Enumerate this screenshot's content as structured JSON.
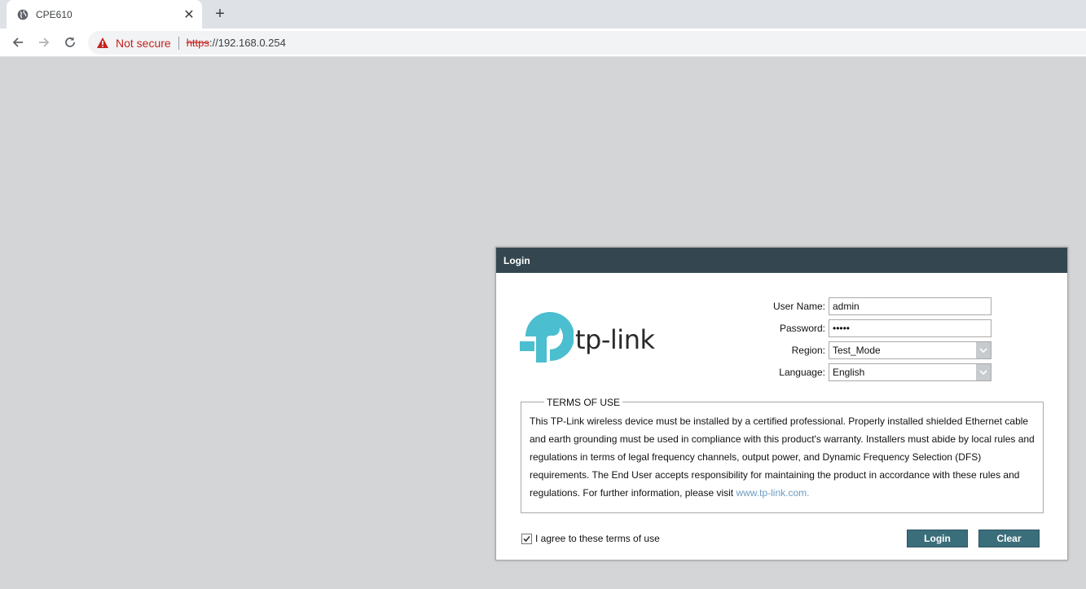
{
  "browser": {
    "tab_title": "CPE610",
    "security_label": "Not secure",
    "url_scheme": "https",
    "url_rest": "://192.168.0.254"
  },
  "dialog": {
    "title": "Login",
    "logo_text": "tp-link",
    "fields": {
      "username_label": "User Name:",
      "username_value": "admin",
      "password_label": "Password:",
      "password_value": "•••••",
      "region_label": "Region:",
      "region_value": "Test_Mode",
      "language_label": "Language:",
      "language_value": "English"
    },
    "terms": {
      "legend": "TERMS OF USE",
      "text": "This TP-Link wireless device must be installed by a certified professional. Properly installed shielded Ethernet cable and earth grounding must be used in compliance with this product's warranty. Installers must abide by local rules and regulations in terms of legal frequency channels, output power, and Dynamic Frequency Selection (DFS) requirements. The End User accepts responsibility for maintaining the product in accordance with these rules and regulations. For further information, please visit ",
      "link": "www.tp-link.com."
    },
    "agree_label": "I agree to these terms of use",
    "agree_checked": true,
    "login_button": "Login",
    "clear_button": "Clear"
  },
  "colors": {
    "header_bg": "#344750",
    "button_bg": "#3b6e7b",
    "logo_teal": "#4bbecf",
    "warning_red": "#c5221f"
  }
}
